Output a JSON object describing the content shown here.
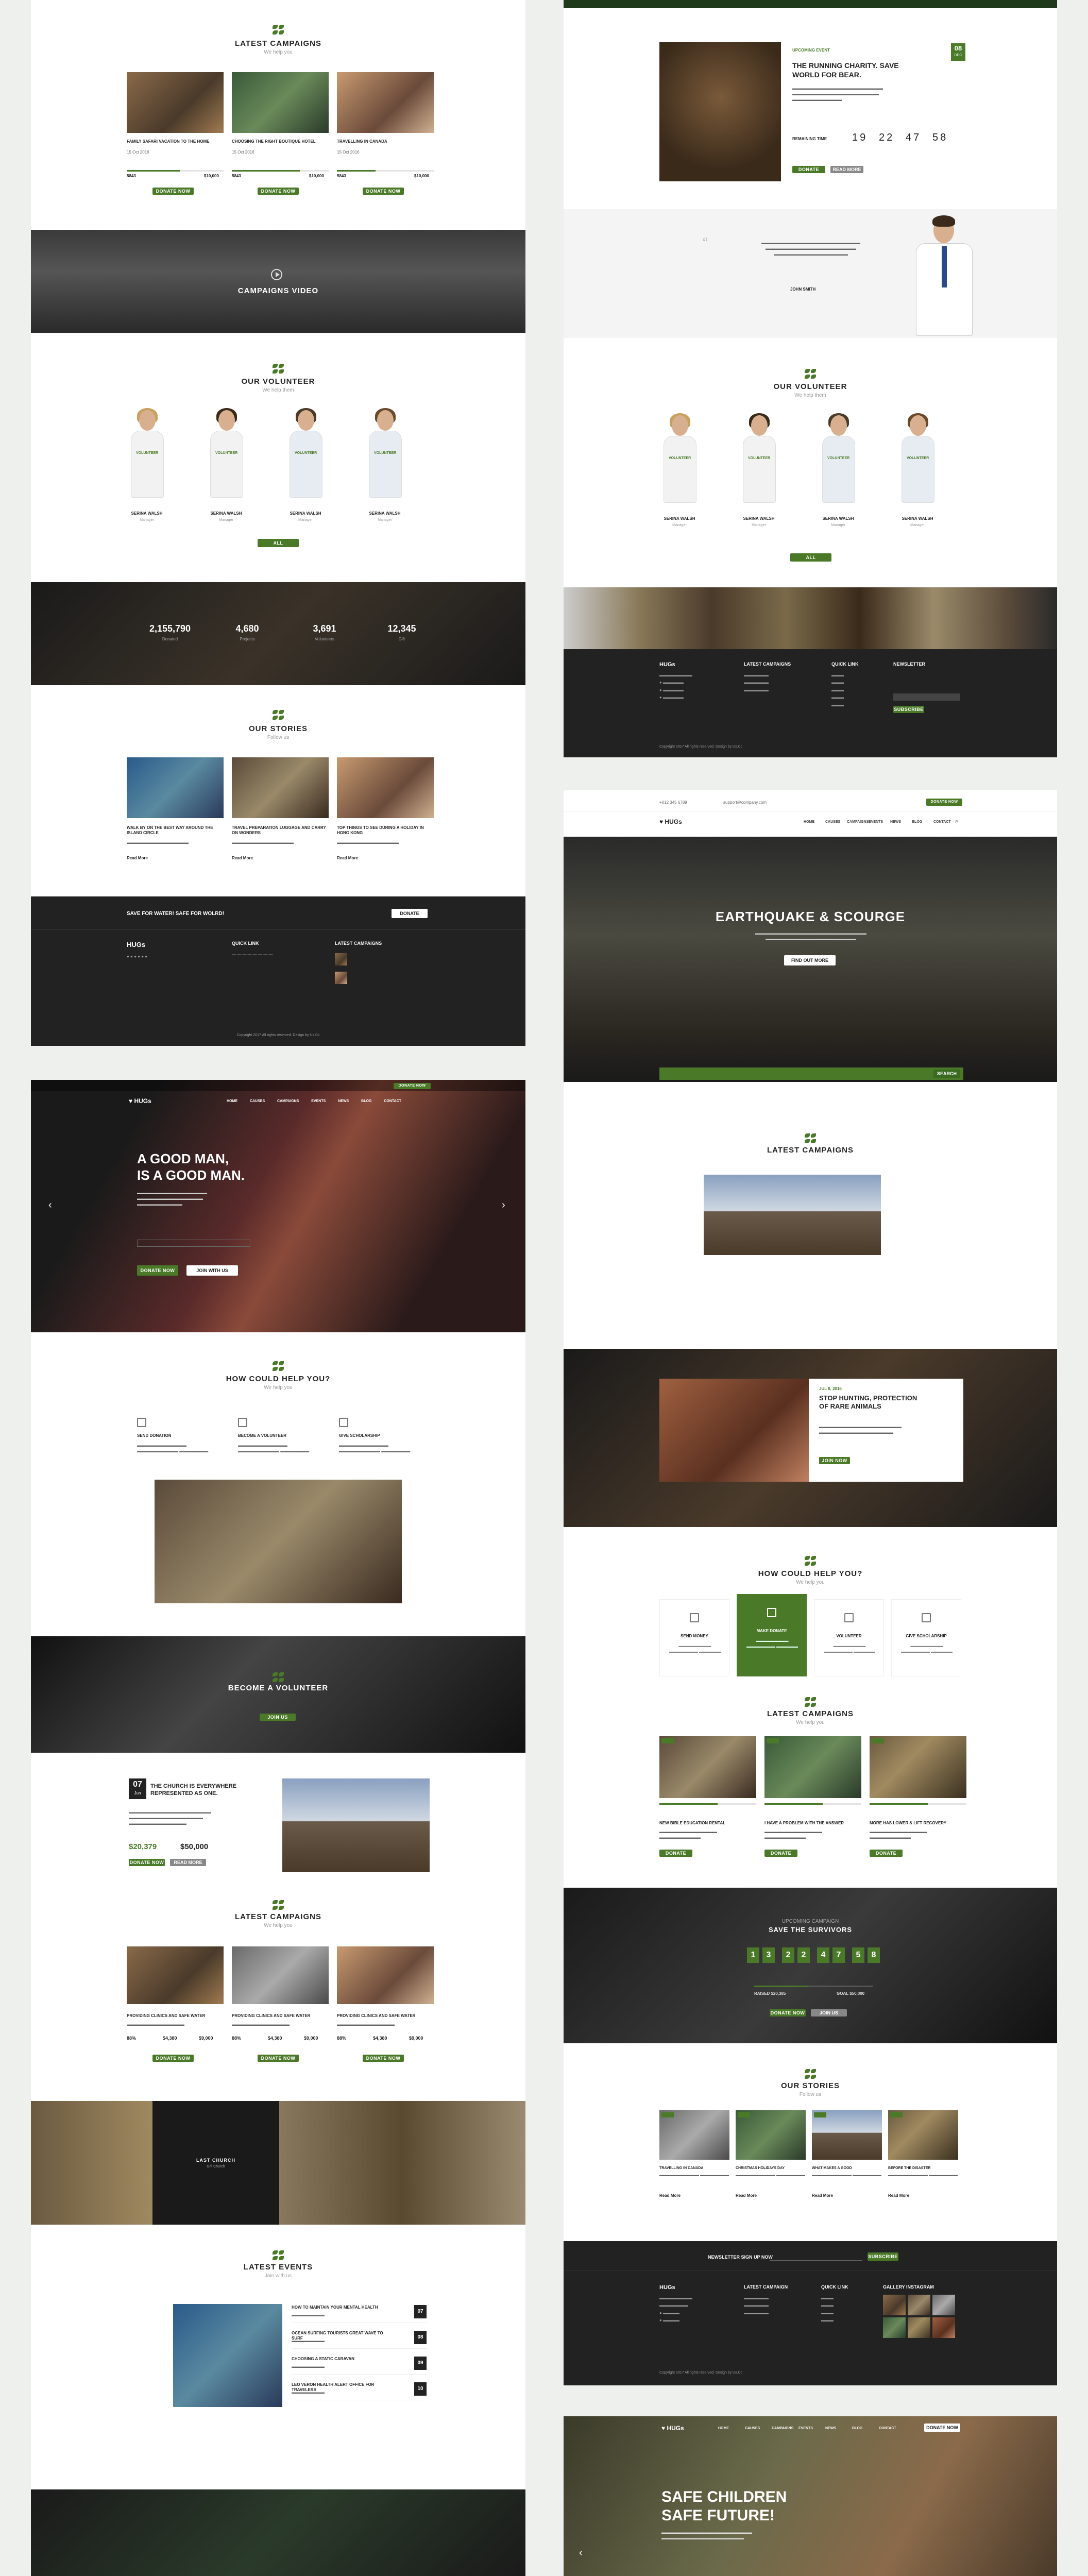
{
  "colA": {
    "latest_campaigns": {
      "title": "LATEST CAMPAIGNS",
      "subtitle": "We help you",
      "items": [
        {
          "title": "FAMILY SAFARI VACATION TO THE HOME",
          "date": "15 Oct 2016",
          "raised": "5843",
          "goal": "$10,000",
          "progress": 0.55,
          "button": "DONATE NOW"
        },
        {
          "title": "CHOOSING THE RIGHT BOUTIQUE HOTEL",
          "date": "15 Oct 2016",
          "raised": "5843",
          "goal": "$10,000",
          "progress": 0.7,
          "button": "DONATE NOW"
        },
        {
          "title": "TRAVELLING IN CANADA",
          "date": "15 Oct 2016",
          "raised": "5843",
          "goal": "$10,000",
          "progress": 0.4,
          "button": "DONATE NOW"
        }
      ]
    },
    "video": {
      "title": "CAMPAIGNS VIDEO"
    },
    "volunteer": {
      "title": "OUR VOLUNTEER",
      "subtitle": "We help them",
      "button": "ALL VOLUNTEER",
      "people": [
        {
          "name": "SERINA WALSH",
          "role": "Manager"
        },
        {
          "name": "SERINA WALSH",
          "role": "Manager"
        },
        {
          "name": "SERINA WALSH",
          "role": "Manager"
        },
        {
          "name": "SERINA WALSH",
          "role": "Manager"
        }
      ]
    },
    "stats": [
      {
        "value": "2,155,790",
        "label": "Donated"
      },
      {
        "value": "4,680",
        "label": "Projects"
      },
      {
        "value": "3,691",
        "label": "Volunteers"
      },
      {
        "value": "12,345",
        "label": "Gift"
      }
    ],
    "stories": {
      "title": "OUR STORIES",
      "subtitle": "Follow us",
      "items": [
        {
          "title": "WALK BY ON THE BEST WAY AROUND THE ISLAND CIRCLE",
          "more": "Read More"
        },
        {
          "title": "TRAVEL PREPARATION LUGGAGE AND CARRY ON WONDERS",
          "more": "Read More"
        },
        {
          "title": "TOP THINGS TO SEE DURING A HOLIDAY IN HONG KONG",
          "more": "Read More"
        }
      ]
    },
    "cta": {
      "text": "SAVE FOR WATER! SAFE FOR WOLRD!",
      "button": "DONATE"
    },
    "footer": {
      "logo": "HUGs",
      "quick_links": "QUICK LINK",
      "latest": "LATEST CAMPAIGNS",
      "copyright": "Copyright 2017 All rights reserved. Design by Us.Cc"
    }
  },
  "colB": {
    "hero": {
      "title_1": "A GOOD MAN,",
      "title_2": "IS A GOOD MAN.",
      "btn1": "DONATE NOW",
      "btn2": "JOIN WITH US",
      "donate_btn": "DONATE NOW"
    },
    "help": {
      "title": "HOW COULD HELP YOU?",
      "subtitle": "We help you",
      "items": [
        {
          "title": "SEND DONATION"
        },
        {
          "title": "BECOME A VOLUNTEER"
        },
        {
          "title": "GIVE SCHOLARSHIP"
        }
      ]
    },
    "volunteer": {
      "title": "BECOME A VOLUNTEER",
      "button": "JOIN US"
    },
    "event": {
      "day": "07",
      "month": "Jun",
      "title_1": "THE CHURCH IS EVERYWHERE",
      "title_2": "REPRESENTED AS ONE.",
      "raised": "$20,379",
      "goal": "$50,000",
      "btn1": "DONATE NOW",
      "btn2": "READ MORE"
    },
    "campaigns": {
      "title": "LATEST CAMPAIGNS",
      "subtitle": "We help you",
      "items": [
        {
          "title": "PROVIDING CLINICS AND SAFE WATER",
          "pct": "88%",
          "raised": "$4,380",
          "goal": "$9,000",
          "button": "DONATE NOW"
        },
        {
          "title": "PROVIDING CLINICS AND SAFE WATER",
          "pct": "88%",
          "raised": "$4,380",
          "goal": "$9,000",
          "button": "DONATE NOW"
        },
        {
          "title": "PROVIDING CLINICS AND SAFE WATER",
          "pct": "88%",
          "raised": "$4,380",
          "goal": "$9,000",
          "button": "DONATE NOW"
        }
      ]
    },
    "church": {
      "title": "LAST CHURCH",
      "subtitle": "Gift Church"
    },
    "events": {
      "title": "LATEST EVENTS",
      "subtitle": "Join with us",
      "items": [
        {
          "title": "HOW TO MAINTAIN YOUR MENTAL HEALTH",
          "day": "07"
        },
        {
          "title": "OCEAN SURFING TOURISTS GREAT WAVE TO SURF",
          "day": "08"
        },
        {
          "title": "CHOOSING A STATIC CARAVAN",
          "day": "09"
        },
        {
          "title": "LEO VERON HEALTH ALERT OFFICE FOR TRAVELERS",
          "day": "10"
        }
      ]
    }
  },
  "colC": {
    "upcoming": {
      "label": "UPCOMING EVENT",
      "title_1": "THE RUNNING CHARITY. SAVE",
      "title_2": "WORLD FOR BEAR.",
      "day": "08",
      "month": "DEC",
      "remaining": "REMAINING TIME",
      "counts": [
        "19",
        "22",
        "47",
        "58"
      ],
      "btn1": "DONATE NOW",
      "btn2": "READ MORE"
    },
    "quote": {
      "author": "JOHN SMITH"
    },
    "volunteer": {
      "title": "OUR VOLUNTEER",
      "subtitle": "We help them",
      "button": "ALL VOLUNTEER",
      "people": [
        {
          "name": "SERINA WALSH",
          "role": "Manager"
        },
        {
          "name": "SERINA WALSH",
          "role": "Manager"
        },
        {
          "name": "SERINA WALSH",
          "role": "Manager"
        },
        {
          "name": "SERINA WALSH",
          "role": "Manager"
        }
      ]
    },
    "footer": {
      "logo": "HUGs",
      "latest": "LATEST CAMPAIGNS",
      "quick": "QUICK LINK",
      "news": "NEWSLETTER",
      "subscribe": "SUBSCRIBE",
      "copyright": "Copyright 2017 All rights reserved. Design by Us.Cc"
    }
  },
  "colD": {
    "topbar": {
      "phone": "+012 345 6789",
      "email": "support@company.com",
      "donate": "DONATE NOW"
    },
    "nav": {
      "logo": "HUGs",
      "items": [
        "HOME",
        "CAUSES",
        "CAMPAIGNS",
        "EVENTS",
        "NEWS",
        "BLOG",
        "CONTACT"
      ]
    },
    "hero": {
      "title": "EARTHQUAKE & SCOURGE",
      "button": "FIND OUT MORE",
      "search": "SEARCH"
    },
    "latest": {
      "title": "LATEST CAMPAIGNS"
    },
    "slider": {
      "date": "JUL 8, 2016",
      "title_1": "STOP HUNTING, PROTECTION",
      "title_2": "OF RARE ANIMALS",
      "button": "JOIN NOW"
    },
    "help": {
      "title": "HOW COULD HELP YOU?",
      "subtitle": "We help you",
      "items": [
        {
          "title": "SEND MONEY"
        },
        {
          "title": "MAKE DONATE"
        },
        {
          "title": "VOLUNTEER"
        },
        {
          "title": "GIVE SCHOLARSHIP"
        }
      ]
    },
    "campaigns": {
      "title": "LATEST CAMPAIGNS",
      "subtitle": "We help you",
      "items": [
        {
          "title": "NEW BIBLE EDUCATION RENTAL",
          "button": "DONATE NOW"
        },
        {
          "title": "I HAVE A PROBLEM WITH THE ANSWER",
          "button": "DONATE NOW"
        },
        {
          "title": "MORE HAS LOWER & LIFT RECOVERY",
          "button": "DONATE NOW"
        }
      ]
    },
    "survivors": {
      "label": "UPCOMING CAMPAIGN",
      "title": "SAVE THE SURVIVORS",
      "counts": [
        "1",
        "3",
        "2",
        "2",
        "4",
        "7",
        "5",
        "8"
      ],
      "raised": "RAISED $20,385",
      "goal": "GOAL $50,000",
      "btn1": "DONATE NOW",
      "btn2": "JOIN US"
    },
    "stories": {
      "title": "OUR STORIES",
      "subtitle": "Follow us",
      "items": [
        {
          "title": "TRAVELLING IN CANADA",
          "more": "Read More"
        },
        {
          "title": "CHRISTMAS HOLIDAYS DAY",
          "more": "Read More"
        },
        {
          "title": "WHAT MAKES A GOOD",
          "more": "Read More"
        },
        {
          "title": "BEFORE THE DISASTER",
          "more": "Read More"
        }
      ]
    },
    "newsletter": {
      "label": "NEWSLETTER SIGN UP NOW",
      "button": "SUBSCRIBE"
    },
    "footer": {
      "logo": "HUGs",
      "latest": "LATEST CAMPAIGN",
      "quick": "QUICK LINK",
      "gallery": "GALLERY INSTAGRAM",
      "copyright": "Copyright 2017 All rights reserved. Design by Us.Cc"
    }
  },
  "colE": {
    "nav": {
      "logo": "HUGs",
      "items": [
        "HOME",
        "CAUSES",
        "CAMPAIGNS",
        "EVENTS",
        "NEWS",
        "BLOG",
        "CONTACT"
      ],
      "donate": "DONATE NOW"
    },
    "hero": {
      "title_1": "SAFE CHILDREN",
      "title_2": "SAFE FUTURE!"
    }
  },
  "colors": {
    "accent": "#4a7a28",
    "dark": "#222222"
  }
}
